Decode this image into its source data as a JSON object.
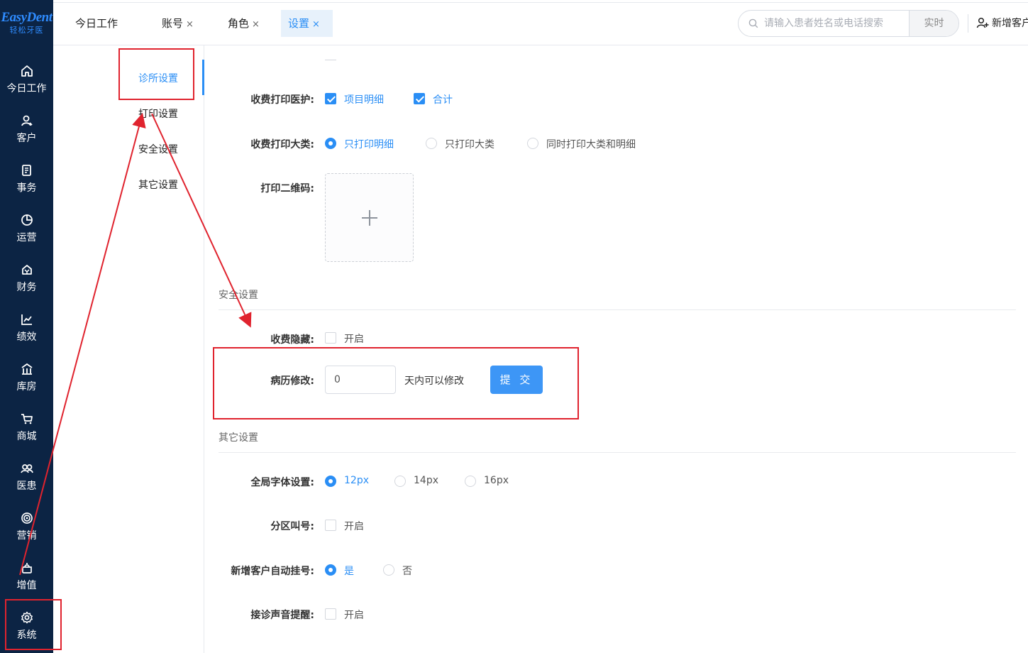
{
  "brand": {
    "name": "EasyDent",
    "sub": "轻松牙医"
  },
  "sidebar": {
    "items": [
      {
        "label": "今日工作",
        "icon": "home-icon"
      },
      {
        "label": "客户",
        "icon": "user-icon"
      },
      {
        "label": "事务",
        "icon": "document-icon"
      },
      {
        "label": "运营",
        "icon": "pie-chart-icon"
      },
      {
        "label": "财务",
        "icon": "wallet-icon"
      },
      {
        "label": "绩效",
        "icon": "line-chart-icon"
      },
      {
        "label": "库房",
        "icon": "warehouse-icon"
      },
      {
        "label": "商城",
        "icon": "cart-icon"
      },
      {
        "label": "医患",
        "icon": "people-icon"
      },
      {
        "label": "营销",
        "icon": "target-icon"
      },
      {
        "label": "增值",
        "icon": "gift-icon"
      },
      {
        "label": "系统",
        "icon": "gear-icon"
      }
    ]
  },
  "tabs": [
    {
      "label": "今日工作",
      "closable": false,
      "active": false
    },
    {
      "label": "账号",
      "closable": true,
      "active": false
    },
    {
      "label": "角色",
      "closable": true,
      "active": false
    },
    {
      "label": "设置",
      "closable": true,
      "active": true
    }
  ],
  "tab_close_glyph": "×",
  "search": {
    "placeholder": "请输入患者姓名或电话搜索",
    "button": "实时"
  },
  "new_customer": "新增客户",
  "subnav": [
    {
      "label": "诊所设置",
      "active": true
    },
    {
      "label": "打印设置",
      "active": false
    },
    {
      "label": "安全设置",
      "active": false
    },
    {
      "label": "其它设置",
      "active": false
    }
  ],
  "print": {
    "medical_label": "收费打印医护:",
    "medical_opts": [
      {
        "label": "项目明细",
        "checked": true
      },
      {
        "label": "合计",
        "checked": true
      }
    ],
    "category_label": "收费打印大类:",
    "category_opts": [
      {
        "label": "只打印明细",
        "checked": true
      },
      {
        "label": "只打印大类",
        "checked": false
      },
      {
        "label": "同时打印大类和明细",
        "checked": false
      }
    ],
    "qr_label": "打印二维码:"
  },
  "security": {
    "title": "安全设置",
    "hide_label": "收费隐藏:",
    "hide_opt": {
      "label": "开启",
      "checked": false
    },
    "record_label": "病历修改:",
    "record_value": "0",
    "record_suffix": "天内可以修改",
    "submit": "提 交"
  },
  "other": {
    "title": "其它设置",
    "font_label": "全局字体设置:",
    "font_opts": [
      {
        "label": "12px",
        "checked": true
      },
      {
        "label": "14px",
        "checked": false
      },
      {
        "label": "16px",
        "checked": false
      }
    ],
    "zone_label": "分区叫号:",
    "zone_opt": {
      "label": "开启",
      "checked": false
    },
    "auto_label": "新增客户自动挂号:",
    "auto_opts": [
      {
        "label": "是",
        "checked": true
      },
      {
        "label": "否",
        "checked": false
      }
    ],
    "sound_label": "接诊声音提醒:",
    "sound_opt": {
      "label": "开启",
      "checked": false
    }
  },
  "colors": {
    "accent": "#2a8ef5",
    "sidebar": "#0c2444",
    "annotation": "#e0232e"
  }
}
